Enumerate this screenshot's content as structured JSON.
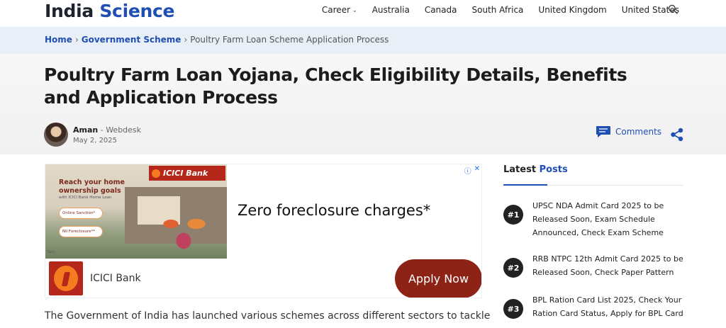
{
  "header": {
    "logo_part1": "India",
    "logo_part2": "Science",
    "nav": [
      {
        "label": "Career",
        "has_dropdown": true
      },
      {
        "label": "Australia"
      },
      {
        "label": "Canada"
      },
      {
        "label": "South Africa"
      },
      {
        "label": "United Kingdom"
      },
      {
        "label": "United States"
      }
    ],
    "search_icon": "search-icon"
  },
  "breadcrumb": {
    "home": "Home",
    "category": "Government Scheme",
    "current": "Poultry Farm Loan Scheme Application Process",
    "separator": "›"
  },
  "article": {
    "title": "Poultry Farm Loan Yojana, Check Eligibility Details, Benefits and Application Process",
    "author": "Aman",
    "role": "- Webdesk",
    "date": "May 2, 2025",
    "comments_label": "Comments",
    "body_start": "The Government of India has launched various schemes across different sectors to tackle"
  },
  "ad": {
    "brand": "ICICI Bank",
    "image_heading": "Reach your home ownership goals",
    "image_sub": "with ICICI Bank Home Loan",
    "pill1": "Online Sanction*",
    "pill2": "Nil Foreclosure**",
    "fine_print": "T&Cs",
    "headline": "Zero foreclosure charges*",
    "bottom_name": "ICICI Bank",
    "cta": "Apply Now",
    "info_icon": "ⓘ",
    "close_icon": "✕"
  },
  "sidebar": {
    "heading_part1": "Latest",
    "heading_part2": "Posts",
    "posts": [
      {
        "num": "#1",
        "title": "UPSC NDA Admit Card 2025 to be Released Soon, Exam Schedule Announced, Check Exam Scheme"
      },
      {
        "num": "#2",
        "title": "RRB NTPC 12th Admit Card 2025 to be Released Soon, Check Paper Pattern"
      },
      {
        "num": "#3",
        "title": "BPL Ration Card List 2025, Check Your Ration Card Status, Apply for BPL Card"
      }
    ]
  },
  "colors": {
    "brand_blue": "#1f4fb5",
    "icici_red": "#b5271a",
    "icici_orange": "#f47b20",
    "apply_button": "#8c2316"
  }
}
